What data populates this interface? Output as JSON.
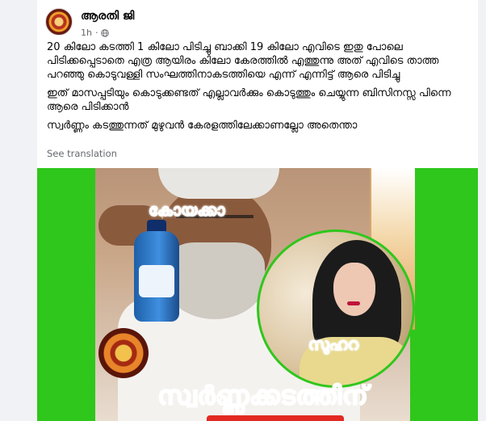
{
  "post": {
    "author": "ആരതി ജി",
    "time": "1h",
    "separator": "·",
    "paragraphs": [
      "20 കിലോ കടത്തി 1 കിലോ പിടിച്ചു ബാക്കി 19 കിലോ എവിടെ ഇതു പോലെ പിടിക്കപ്പെടാതെ എത്ര ആയിരം കിലോ കേരത്തിൽ എത്തുന്നു അത് എവിടെ താത്ത പറഞ്ഞു കൊടുവള്ളി സംഘത്തിനാകടത്തിയെ എന്ന് എന്നിട്ട് ആരെ പിടിച്ചു",
      "ഇത് മാസപ്പടിയും കൊടുക്കണ്ടത് എല്ലാവർക്കും കൊടുത്തും ചെയ്യുന്ന ബിസിനസ്സ പിന്നെ ആരെ പിടിക്കാൻ",
      "സ്വർണ്ണം കടത്തുന്നത് മുഴുവൻ കേരളത്തിലേക്കാണല്ലോ അതെന്താ"
    ],
    "see_translation": "See translation"
  },
  "image": {
    "label_top": "കോയക്കാ",
    "label_woman": "സുഹറ",
    "caption": "സ്വർണ്ണക്കടത്തിന്"
  },
  "colors": {
    "background": "#2fc71c",
    "label_red": "#d41a10"
  },
  "icons": [
    "globe-icon"
  ]
}
